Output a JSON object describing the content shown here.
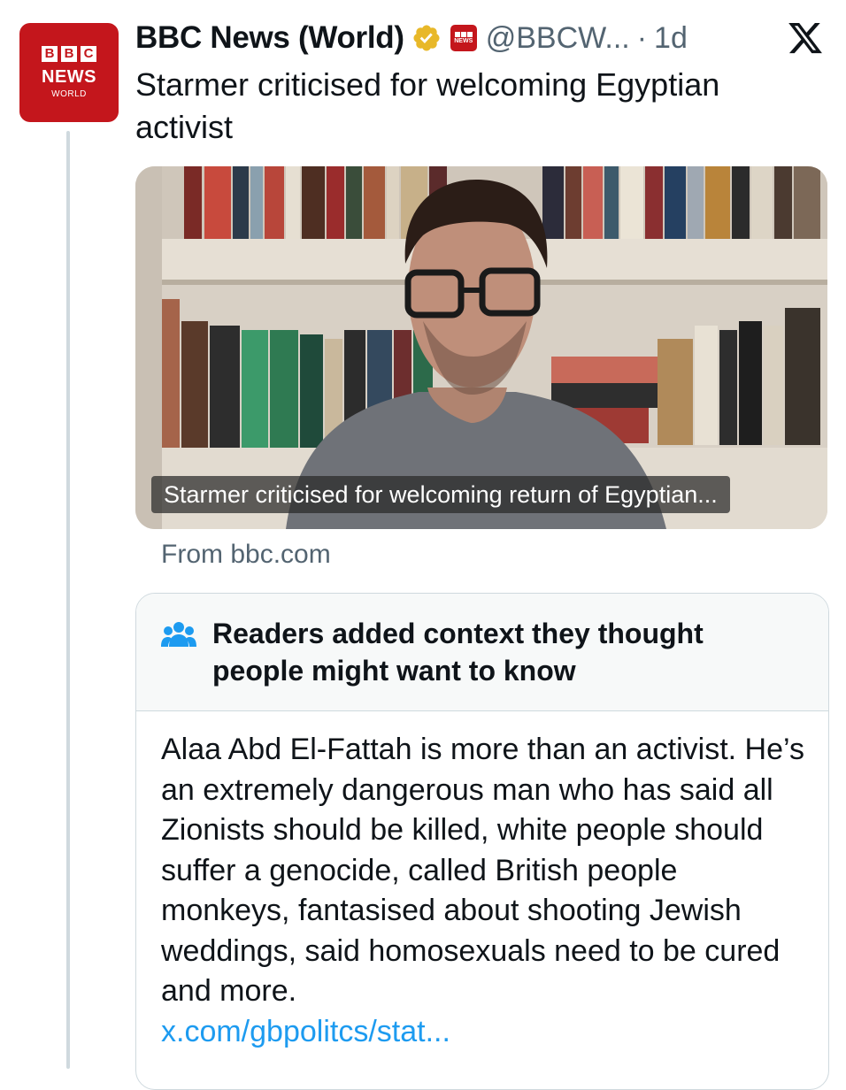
{
  "author": {
    "avatar_blocks": [
      "B",
      "B",
      "C"
    ],
    "avatar_news": "NEWS",
    "avatar_world": "WORLD",
    "display_name": "BBC News (World)",
    "handle": "@BBCW...",
    "separator": "·",
    "timestamp": "1d",
    "verified_color": "#e8b829",
    "affiliate_color": "#c4161c"
  },
  "tweet": {
    "text": "Starmer criticised for welcoming Egyptian activist"
  },
  "media": {
    "caption": "Starmer criticised for welcoming return of Egyptian...",
    "source": "From bbc.com"
  },
  "community_note": {
    "title": "Readers added context they thought people might want to know",
    "body": "Alaa Abd El-Fattah is more than an activist. He’s an extremely dangerous man who has said all Zionists should be killed, white people should suffer a genocide, called British people monkeys, fantasised about shooting Jewish weddings, said homosexuals need to be cured and more.",
    "link": "x.com/gbpolitcs/stat...",
    "link_color": "#1d9bf0"
  },
  "icons": {
    "platform": "x-logo-icon",
    "note": "people-icon",
    "verified": "verified-badge-icon"
  }
}
